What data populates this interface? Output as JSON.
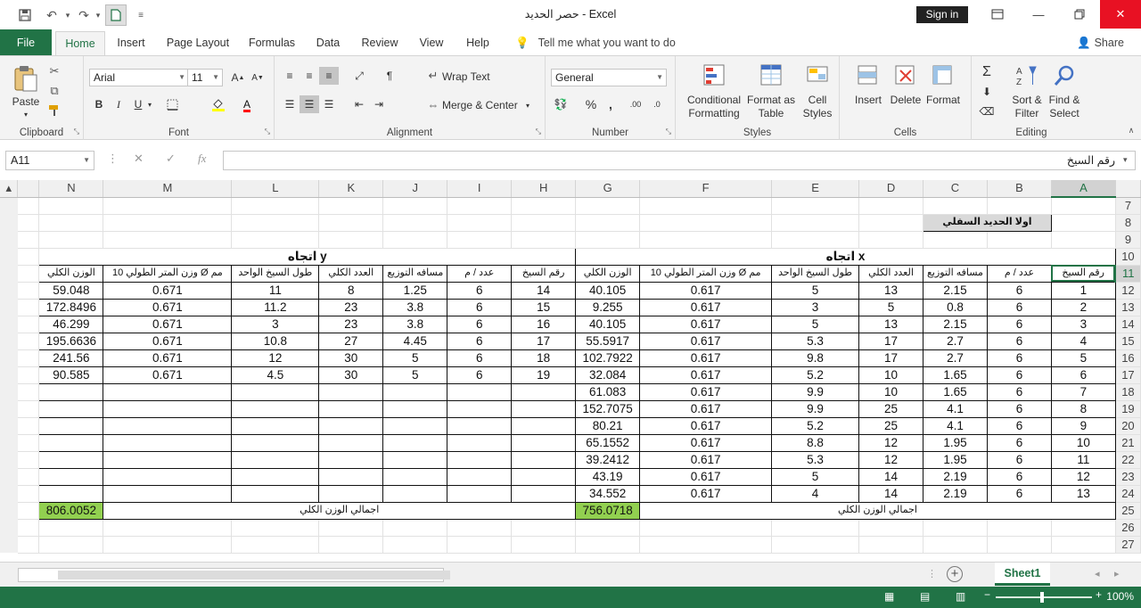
{
  "window": {
    "title": "حصر الحديد  -  Excel",
    "sign_in": "Sign in"
  },
  "tabs": {
    "file": "File",
    "items": [
      "Home",
      "Insert",
      "Page Layout",
      "Formulas",
      "Data",
      "Review",
      "View",
      "Help"
    ],
    "active": "Home",
    "tell_me": "Tell me what you want to do",
    "share": "Share"
  },
  "ribbon": {
    "clipboard": {
      "label": "Clipboard",
      "paste": "Paste"
    },
    "font": {
      "label": "Font",
      "family": "Arial",
      "size": "11",
      "bold": "B",
      "italic": "I",
      "underline": "U"
    },
    "alignment": {
      "label": "Alignment",
      "wrap_text": "Wrap Text",
      "merge_center": "Merge & Center"
    },
    "number": {
      "label": "Number",
      "format": "General",
      "percent": "%",
      "comma": ","
    },
    "styles": {
      "label": "Styles",
      "conditional_formatting": "Conditional\nFormatting",
      "format_as_table": "Format as\nTable",
      "cell_styles": "Cell\nStyles"
    },
    "cells": {
      "label": "Cells",
      "insert": "Insert",
      "delete": "Delete",
      "format": "Format"
    },
    "editing": {
      "label": "Editing",
      "sort_filter": "Sort &\nFilter",
      "find_select": "Find &\nSelect"
    }
  },
  "formula_bar": {
    "name_box": "A11",
    "content": "رقم السيخ"
  },
  "grid": {
    "columns": [
      "N",
      "M",
      "L",
      "K",
      "J",
      "I",
      "H",
      "G",
      "F",
      "E",
      "D",
      "C",
      "B",
      "A"
    ],
    "selected_column": "A",
    "rows": [
      "7",
      "8",
      "9",
      "10",
      "11",
      "12",
      "13",
      "14",
      "15",
      "16",
      "17",
      "18",
      "19",
      "20",
      "21",
      "22",
      "23",
      "24",
      "25",
      "26",
      "27"
    ],
    "selected_row": "11",
    "section_title": "اولا الحديد السفلي",
    "dir_y": "اتجاه y",
    "dir_x": "اتجاه x",
    "headers_y": [
      "الوزن الكلي",
      "وزن المتر الطولي 10 Ø مم",
      "طول السيخ الواحد",
      "العدد الكلي",
      "مسافه التوزيع",
      "عدد / م",
      "رقم السيخ"
    ],
    "headers_x": [
      "الوزن الكلي",
      "وزن المتر الطولي 10 Ø مم",
      "طول السيخ الواحد",
      "العدد الكلي",
      "مسافه التوزيع",
      "عدد / م",
      "رقم السيخ"
    ],
    "data_y": [
      [
        "59.048",
        "0.671",
        "11",
        "8",
        "1.25",
        "6",
        "14"
      ],
      [
        "172.8496",
        "0.671",
        "11.2",
        "23",
        "3.8",
        "6",
        "15"
      ],
      [
        "46.299",
        "0.671",
        "3",
        "23",
        "3.8",
        "6",
        "16"
      ],
      [
        "195.6636",
        "0.671",
        "10.8",
        "27",
        "4.45",
        "6",
        "17"
      ],
      [
        "241.56",
        "0.671",
        "12",
        "30",
        "5",
        "6",
        "18"
      ],
      [
        "90.585",
        "0.671",
        "4.5",
        "30",
        "5",
        "6",
        "19"
      ]
    ],
    "data_x": [
      [
        "40.105",
        "0.617",
        "5",
        "13",
        "2.15",
        "6",
        "1"
      ],
      [
        "9.255",
        "0.617",
        "3",
        "5",
        "0.8",
        "6",
        "2"
      ],
      [
        "40.105",
        "0.617",
        "5",
        "13",
        "2.15",
        "6",
        "3"
      ],
      [
        "55.5917",
        "0.617",
        "5.3",
        "17",
        "2.7",
        "6",
        "4"
      ],
      [
        "102.7922",
        "0.617",
        "9.8",
        "17",
        "2.7",
        "6",
        "5"
      ],
      [
        "32.084",
        "0.617",
        "5.2",
        "10",
        "1.65",
        "6",
        "6"
      ],
      [
        "61.083",
        "0.617",
        "9.9",
        "10",
        "1.65",
        "6",
        "7"
      ],
      [
        "152.7075",
        "0.617",
        "9.9",
        "25",
        "4.1",
        "6",
        "8"
      ],
      [
        "80.21",
        "0.617",
        "5.2",
        "25",
        "4.1",
        "6",
        "9"
      ],
      [
        "65.1552",
        "0.617",
        "8.8",
        "12",
        "1.95",
        "6",
        "10"
      ],
      [
        "39.2412",
        "0.617",
        "5.3",
        "12",
        "1.95",
        "6",
        "11"
      ],
      [
        "43.19",
        "0.617",
        "5",
        "14",
        "2.19",
        "6",
        "12"
      ],
      [
        "34.552",
        "0.617",
        "4",
        "14",
        "2.19",
        "6",
        "13"
      ]
    ],
    "total_label": "اجمالي الوزن الكلي",
    "total_y": "806.0052",
    "total_x": "756.0718"
  },
  "sheets": {
    "active": "Sheet1"
  },
  "status": {
    "zoom": "100%"
  },
  "colors": {
    "excel_green": "#217346",
    "total_fill": "#92d050",
    "title_fill": "#d9d9d9"
  }
}
